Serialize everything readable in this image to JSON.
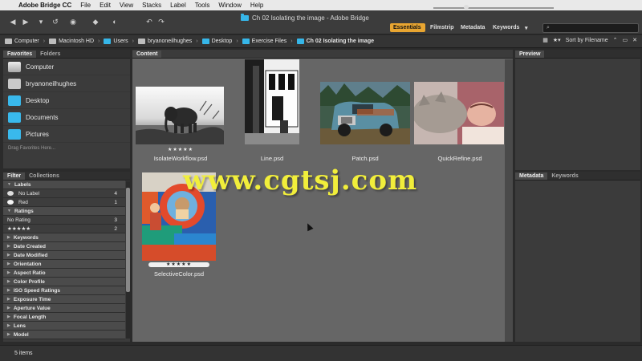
{
  "menubar": {
    "apple": "",
    "app_name": "Adobe Bridge CC",
    "items": [
      "File",
      "Edit",
      "View",
      "Stacks",
      "Label",
      "Tools",
      "Window",
      "Help"
    ]
  },
  "toolbar": {
    "window_title": "Ch 02 Isolating the image - Adobe Bridge",
    "workspaces": [
      "Essentials",
      "Filmstrip",
      "Metadata",
      "Keywords"
    ],
    "active_workspace": "Essentials",
    "search_placeholder": "⌕",
    "icons": [
      "back-icon",
      "forward-icon",
      "reveal-recent-icon",
      "boomerang-icon",
      "camera-icon",
      "refine-icon",
      "open-in-camera-raw-icon",
      "rotate-left-icon",
      "rotate-right-icon"
    ]
  },
  "pathbar": {
    "crumbs": [
      "Computer",
      "Macintosh HD",
      "Users",
      "bryanoneilhughes",
      "Desktop",
      "Exercise Files",
      "Ch 02 Isolating the image"
    ],
    "sort_label": "Sort by Filename"
  },
  "favorites": {
    "tabs": [
      "Favorites",
      "Folders"
    ],
    "items": [
      "Computer",
      "bryanoneilhughes",
      "Desktop",
      "Documents",
      "Pictures"
    ],
    "hint": "Drag Favorites Here..."
  },
  "filter": {
    "tabs": [
      "Filter",
      "Collections"
    ],
    "labels_head": "Labels",
    "label_items": [
      {
        "name": "No Label",
        "count": "4"
      },
      {
        "name": "Red",
        "count": "1"
      }
    ],
    "ratings_head": "Ratings",
    "rating_items": [
      {
        "name": "No Rating",
        "count": "3"
      },
      {
        "name": "★★★★★",
        "count": "2"
      }
    ],
    "sections": [
      "Keywords",
      "Date Created",
      "Date Modified",
      "Orientation",
      "Aspect Ratio",
      "Color Profile",
      "ISO Speed Ratings",
      "Exposure Time",
      "Aperture Value",
      "Focal Length",
      "Lens",
      "Model"
    ]
  },
  "content": {
    "tab": "Content",
    "files": [
      {
        "name": "IsolateWorkflow.psd",
        "rating": "★★★★★"
      },
      {
        "name": "Line.psd",
        "rating": ""
      },
      {
        "name": "Patch.psd",
        "rating": ""
      },
      {
        "name": "QuickRefine.psd",
        "rating": ""
      },
      {
        "name": "SelectiveColor.psd",
        "rating": "★★★★★"
      }
    ]
  },
  "right": {
    "preview_tab": "Preview",
    "meta_tabs": [
      "Metadata",
      "Keywords"
    ]
  },
  "status": {
    "items": "5 items"
  },
  "watermark": "www.cgtsj.com"
}
